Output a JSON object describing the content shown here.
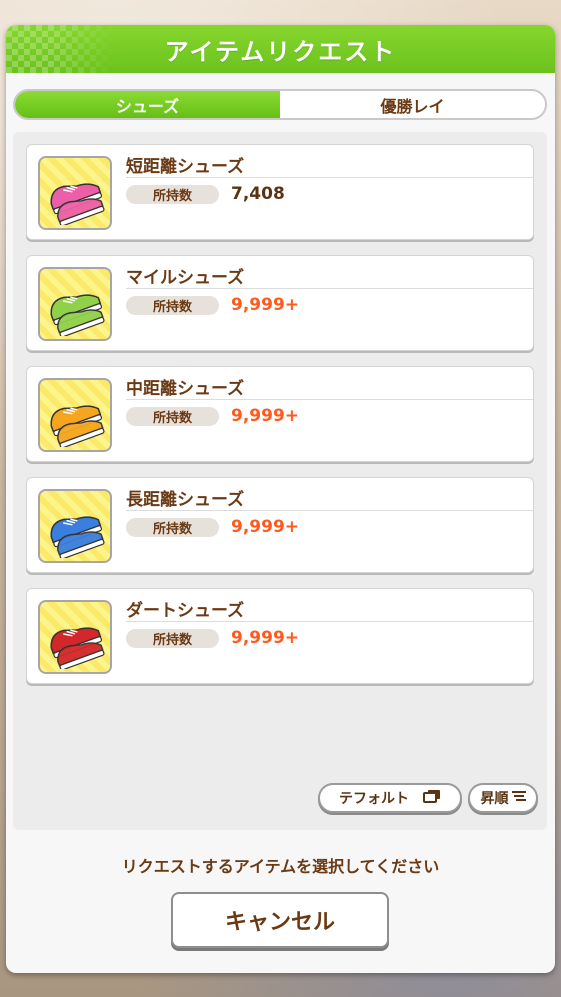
{
  "dialog": {
    "title": "アイテムリクエスト"
  },
  "tabs": [
    {
      "label": "シューズ",
      "active": true
    },
    {
      "label": "優勝レイ",
      "active": false
    }
  ],
  "items": [
    {
      "name": "短距離シューズ",
      "owned_label": "所持数",
      "count": "7,408",
      "count_color": "#5a3412",
      "shoe_color": "#ec5fa8",
      "icon": "pink-shoes-icon"
    },
    {
      "name": "マイルシューズ",
      "owned_label": "所持数",
      "count": "9,999+",
      "count_color": "#ff5a1e",
      "shoe_color": "#8fd24a",
      "icon": "green-shoes-icon"
    },
    {
      "name": "中距離シューズ",
      "owned_label": "所持数",
      "count": "9,999+",
      "count_color": "#ff5a1e",
      "shoe_color": "#f5a51e",
      "icon": "orange-shoes-icon"
    },
    {
      "name": "長距離シューズ",
      "owned_label": "所持数",
      "count": "9,999+",
      "count_color": "#ff5a1e",
      "shoe_color": "#3a7ee0",
      "icon": "blue-shoes-icon"
    },
    {
      "name": "ダートシューズ",
      "owned_label": "所持数",
      "count": "9,999+",
      "count_color": "#ff5a1e",
      "shoe_color": "#d2272b",
      "icon": "red-shoes-icon"
    }
  ],
  "sort": {
    "default_label": "テフォルト",
    "order_label": "昇順"
  },
  "prompt": "リクエストするアイテムを選択してください",
  "cancel_label": "キャンセル",
  "colors": {
    "accent": "#6cc21d",
    "text_brown": "#6a3a14",
    "count_highlight": "#ff5a1e"
  }
}
